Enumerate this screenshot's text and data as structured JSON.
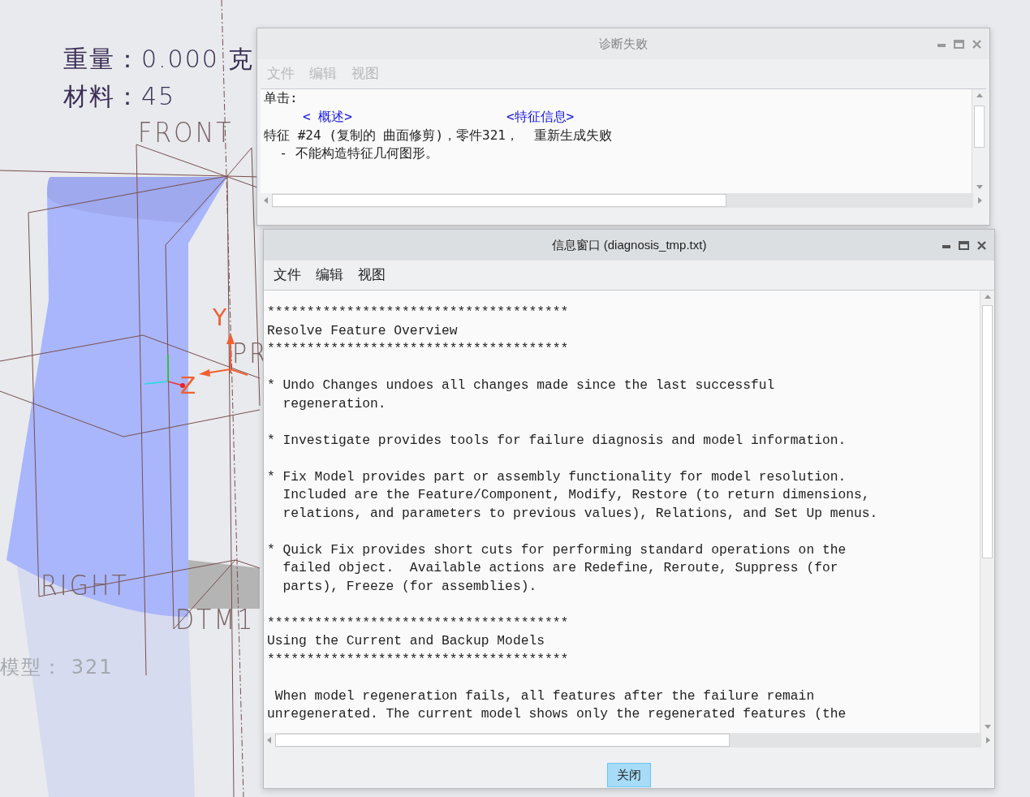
{
  "viewport": {
    "labels": [
      {
        "kind": "note",
        "text": "重量：0.000 克"
      },
      {
        "kind": "note",
        "text": "材料：45"
      },
      {
        "kind": "datum",
        "text": "FRONT"
      },
      {
        "kind": "axis",
        "text": "Y"
      },
      {
        "kind": "datum",
        "text": "PR"
      },
      {
        "kind": "axis",
        "text": "Z"
      },
      {
        "kind": "datum",
        "text": "RIGHT"
      },
      {
        "kind": "datum",
        "text": "DTM1"
      },
      {
        "kind": "faint",
        "text": "模型：  321"
      }
    ]
  },
  "diagnosis_window": {
    "title": "诊断失败",
    "active": false,
    "menu": [
      {
        "label": "文件",
        "disabled": true
      },
      {
        "label": "编辑",
        "disabled": true
      },
      {
        "label": "视图",
        "disabled": true
      }
    ],
    "prompt": "单击:",
    "links": [
      "< 概述>",
      "<特征信息>"
    ],
    "message": "特征 #24 (复制的 曲面修剪)，零件321，  重新生成失败",
    "detail": "  - 不能构造特征几何图形。"
  },
  "info_window": {
    "title": "信息窗口 (diagnosis_tmp.txt)",
    "active": true,
    "menu": [
      {
        "label": "文件",
        "disabled": false
      },
      {
        "label": "编辑",
        "disabled": false
      },
      {
        "label": "视图",
        "disabled": false
      }
    ],
    "blocks": [
      [
        "**************************************",
        "Resolve Feature Overview",
        "**************************************"
      ],
      [
        "* Undo Changes undoes all changes made since the last successful",
        "  regeneration."
      ],
      [
        "* Investigate provides tools for failure diagnosis and model information."
      ],
      [
        "* Fix Model provides part or assembly functionality for model resolution.",
        "  Included are the Feature/Component, Modify, Restore (to return dimensions,",
        "  relations, and parameters to previous values), Relations, and Set Up menus."
      ],
      [
        "* Quick Fix provides short cuts for performing standard operations on the",
        "  failed object.  Available actions are Redefine, Reroute, Suppress (for",
        "  parts), Freeze (for assemblies)."
      ],
      [
        "**************************************",
        "Using the Current and Backup Models",
        "**************************************"
      ],
      [
        " When model regeneration fails, all features after the failure remain",
        "unregenerated. The current model shows only the regenerated features (the"
      ]
    ],
    "close_button": "关闭"
  }
}
